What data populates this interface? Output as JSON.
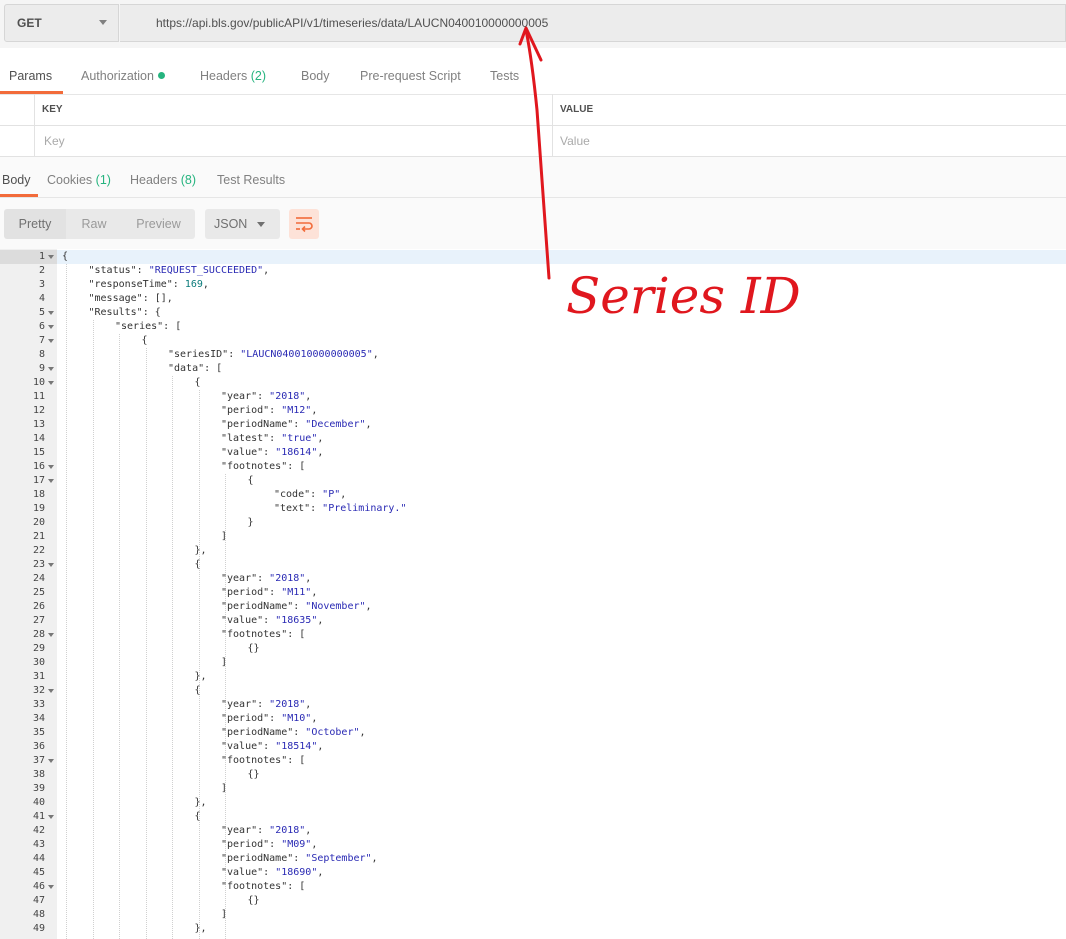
{
  "request": {
    "method": "GET",
    "url": "https://api.bls.gov/publicAPI/v1/timeseries/data/LAUCN040010000000005"
  },
  "request_tabs": [
    {
      "label": "Params",
      "count": ""
    },
    {
      "label": "Authorization",
      "count": ""
    },
    {
      "label": "Headers",
      "count": "(2)"
    },
    {
      "label": "Body",
      "count": ""
    },
    {
      "label": "Pre-request Script",
      "count": ""
    },
    {
      "label": "Tests",
      "count": ""
    }
  ],
  "params": {
    "key_header": "KEY",
    "value_header": "VALUE",
    "key_placeholder": "Key",
    "value_placeholder": "Value"
  },
  "response_tabs": [
    {
      "label": "Body",
      "count": ""
    },
    {
      "label": "Cookies",
      "count": "(1)"
    },
    {
      "label": "Headers",
      "count": "(8)"
    },
    {
      "label": "Test Results",
      "count": ""
    }
  ],
  "view": {
    "pretty": "Pretty",
    "raw": "Raw",
    "preview": "Preview",
    "format": "JSON"
  },
  "annotation": "Series ID",
  "code_lines": [
    {
      "n": "1",
      "fold": true,
      "indent": 0,
      "tokens": [
        [
          "p",
          "{"
        ]
      ]
    },
    {
      "n": "2",
      "fold": false,
      "indent": 1,
      "tokens": [
        [
          "k",
          "\"status\""
        ],
        [
          "p",
          ": "
        ],
        [
          "s",
          "\"REQUEST_SUCCEEDED\""
        ],
        [
          "p",
          ","
        ]
      ]
    },
    {
      "n": "3",
      "fold": false,
      "indent": 1,
      "tokens": [
        [
          "k",
          "\"responseTime\""
        ],
        [
          "p",
          ": "
        ],
        [
          "n",
          "169"
        ],
        [
          "p",
          ","
        ]
      ]
    },
    {
      "n": "4",
      "fold": false,
      "indent": 1,
      "tokens": [
        [
          "k",
          "\"message\""
        ],
        [
          "p",
          ": [],"
        ]
      ]
    },
    {
      "n": "5",
      "fold": true,
      "indent": 1,
      "tokens": [
        [
          "k",
          "\"Results\""
        ],
        [
          "p",
          ": {"
        ]
      ]
    },
    {
      "n": "6",
      "fold": true,
      "indent": 2,
      "tokens": [
        [
          "k",
          "\"series\""
        ],
        [
          "p",
          ": ["
        ]
      ]
    },
    {
      "n": "7",
      "fold": true,
      "indent": 3,
      "tokens": [
        [
          "p",
          "{"
        ]
      ]
    },
    {
      "n": "8",
      "fold": false,
      "indent": 4,
      "tokens": [
        [
          "k",
          "\"seriesID\""
        ],
        [
          "p",
          ": "
        ],
        [
          "s",
          "\"LAUCN040010000000005\""
        ],
        [
          "p",
          ","
        ]
      ]
    },
    {
      "n": "9",
      "fold": true,
      "indent": 4,
      "tokens": [
        [
          "k",
          "\"data\""
        ],
        [
          "p",
          ": ["
        ]
      ]
    },
    {
      "n": "10",
      "fold": true,
      "indent": 5,
      "tokens": [
        [
          "p",
          "{"
        ]
      ]
    },
    {
      "n": "11",
      "fold": false,
      "indent": 6,
      "tokens": [
        [
          "k",
          "\"year\""
        ],
        [
          "p",
          ": "
        ],
        [
          "s",
          "\"2018\""
        ],
        [
          "p",
          ","
        ]
      ]
    },
    {
      "n": "12",
      "fold": false,
      "indent": 6,
      "tokens": [
        [
          "k",
          "\"period\""
        ],
        [
          "p",
          ": "
        ],
        [
          "s",
          "\"M12\""
        ],
        [
          "p",
          ","
        ]
      ]
    },
    {
      "n": "13",
      "fold": false,
      "indent": 6,
      "tokens": [
        [
          "k",
          "\"periodName\""
        ],
        [
          "p",
          ": "
        ],
        [
          "s",
          "\"December\""
        ],
        [
          "p",
          ","
        ]
      ]
    },
    {
      "n": "14",
      "fold": false,
      "indent": 6,
      "tokens": [
        [
          "k",
          "\"latest\""
        ],
        [
          "p",
          ": "
        ],
        [
          "s",
          "\"true\""
        ],
        [
          "p",
          ","
        ]
      ]
    },
    {
      "n": "15",
      "fold": false,
      "indent": 6,
      "tokens": [
        [
          "k",
          "\"value\""
        ],
        [
          "p",
          ": "
        ],
        [
          "s",
          "\"18614\""
        ],
        [
          "p",
          ","
        ]
      ]
    },
    {
      "n": "16",
      "fold": true,
      "indent": 6,
      "tokens": [
        [
          "k",
          "\"footnotes\""
        ],
        [
          "p",
          ": ["
        ]
      ]
    },
    {
      "n": "17",
      "fold": true,
      "indent": 7,
      "tokens": [
        [
          "p",
          "{"
        ]
      ]
    },
    {
      "n": "18",
      "fold": false,
      "indent": 8,
      "tokens": [
        [
          "k",
          "\"code\""
        ],
        [
          "p",
          ": "
        ],
        [
          "s",
          "\"P\""
        ],
        [
          "p",
          ","
        ]
      ]
    },
    {
      "n": "19",
      "fold": false,
      "indent": 8,
      "tokens": [
        [
          "k",
          "\"text\""
        ],
        [
          "p",
          ": "
        ],
        [
          "s",
          "\"Preliminary.\""
        ]
      ]
    },
    {
      "n": "20",
      "fold": false,
      "indent": 7,
      "tokens": [
        [
          "p",
          "}"
        ]
      ]
    },
    {
      "n": "21",
      "fold": false,
      "indent": 6,
      "tokens": [
        [
          "p",
          "]"
        ]
      ]
    },
    {
      "n": "22",
      "fold": false,
      "indent": 5,
      "tokens": [
        [
          "p",
          "},"
        ]
      ]
    },
    {
      "n": "23",
      "fold": true,
      "indent": 5,
      "tokens": [
        [
          "p",
          "{"
        ]
      ]
    },
    {
      "n": "24",
      "fold": false,
      "indent": 6,
      "tokens": [
        [
          "k",
          "\"year\""
        ],
        [
          "p",
          ": "
        ],
        [
          "s",
          "\"2018\""
        ],
        [
          "p",
          ","
        ]
      ]
    },
    {
      "n": "25",
      "fold": false,
      "indent": 6,
      "tokens": [
        [
          "k",
          "\"period\""
        ],
        [
          "p",
          ": "
        ],
        [
          "s",
          "\"M11\""
        ],
        [
          "p",
          ","
        ]
      ]
    },
    {
      "n": "26",
      "fold": false,
      "indent": 6,
      "tokens": [
        [
          "k",
          "\"periodName\""
        ],
        [
          "p",
          ": "
        ],
        [
          "s",
          "\"November\""
        ],
        [
          "p",
          ","
        ]
      ]
    },
    {
      "n": "27",
      "fold": false,
      "indent": 6,
      "tokens": [
        [
          "k",
          "\"value\""
        ],
        [
          "p",
          ": "
        ],
        [
          "s",
          "\"18635\""
        ],
        [
          "p",
          ","
        ]
      ]
    },
    {
      "n": "28",
      "fold": true,
      "indent": 6,
      "tokens": [
        [
          "k",
          "\"footnotes\""
        ],
        [
          "p",
          ": ["
        ]
      ]
    },
    {
      "n": "29",
      "fold": false,
      "indent": 7,
      "tokens": [
        [
          "p",
          "{}"
        ]
      ]
    },
    {
      "n": "30",
      "fold": false,
      "indent": 6,
      "tokens": [
        [
          "p",
          "]"
        ]
      ]
    },
    {
      "n": "31",
      "fold": false,
      "indent": 5,
      "tokens": [
        [
          "p",
          "},"
        ]
      ]
    },
    {
      "n": "32",
      "fold": true,
      "indent": 5,
      "tokens": [
        [
          "p",
          "{"
        ]
      ]
    },
    {
      "n": "33",
      "fold": false,
      "indent": 6,
      "tokens": [
        [
          "k",
          "\"year\""
        ],
        [
          "p",
          ": "
        ],
        [
          "s",
          "\"2018\""
        ],
        [
          "p",
          ","
        ]
      ]
    },
    {
      "n": "34",
      "fold": false,
      "indent": 6,
      "tokens": [
        [
          "k",
          "\"period\""
        ],
        [
          "p",
          ": "
        ],
        [
          "s",
          "\"M10\""
        ],
        [
          "p",
          ","
        ]
      ]
    },
    {
      "n": "35",
      "fold": false,
      "indent": 6,
      "tokens": [
        [
          "k",
          "\"periodName\""
        ],
        [
          "p",
          ": "
        ],
        [
          "s",
          "\"October\""
        ],
        [
          "p",
          ","
        ]
      ]
    },
    {
      "n": "36",
      "fold": false,
      "indent": 6,
      "tokens": [
        [
          "k",
          "\"value\""
        ],
        [
          "p",
          ": "
        ],
        [
          "s",
          "\"18514\""
        ],
        [
          "p",
          ","
        ]
      ]
    },
    {
      "n": "37",
      "fold": true,
      "indent": 6,
      "tokens": [
        [
          "k",
          "\"footnotes\""
        ],
        [
          "p",
          ": ["
        ]
      ]
    },
    {
      "n": "38",
      "fold": false,
      "indent": 7,
      "tokens": [
        [
          "p",
          "{}"
        ]
      ]
    },
    {
      "n": "39",
      "fold": false,
      "indent": 6,
      "tokens": [
        [
          "p",
          "]"
        ]
      ]
    },
    {
      "n": "40",
      "fold": false,
      "indent": 5,
      "tokens": [
        [
          "p",
          "},"
        ]
      ]
    },
    {
      "n": "41",
      "fold": true,
      "indent": 5,
      "tokens": [
        [
          "p",
          "{"
        ]
      ]
    },
    {
      "n": "42",
      "fold": false,
      "indent": 6,
      "tokens": [
        [
          "k",
          "\"year\""
        ],
        [
          "p",
          ": "
        ],
        [
          "s",
          "\"2018\""
        ],
        [
          "p",
          ","
        ]
      ]
    },
    {
      "n": "43",
      "fold": false,
      "indent": 6,
      "tokens": [
        [
          "k",
          "\"period\""
        ],
        [
          "p",
          ": "
        ],
        [
          "s",
          "\"M09\""
        ],
        [
          "p",
          ","
        ]
      ]
    },
    {
      "n": "44",
      "fold": false,
      "indent": 6,
      "tokens": [
        [
          "k",
          "\"periodName\""
        ],
        [
          "p",
          ": "
        ],
        [
          "s",
          "\"September\""
        ],
        [
          "p",
          ","
        ]
      ]
    },
    {
      "n": "45",
      "fold": false,
      "indent": 6,
      "tokens": [
        [
          "k",
          "\"value\""
        ],
        [
          "p",
          ": "
        ],
        [
          "s",
          "\"18690\""
        ],
        [
          "p",
          ","
        ]
      ]
    },
    {
      "n": "46",
      "fold": true,
      "indent": 6,
      "tokens": [
        [
          "k",
          "\"footnotes\""
        ],
        [
          "p",
          ": ["
        ]
      ]
    },
    {
      "n": "47",
      "fold": false,
      "indent": 7,
      "tokens": [
        [
          "p",
          "{}"
        ]
      ]
    },
    {
      "n": "48",
      "fold": false,
      "indent": 6,
      "tokens": [
        [
          "p",
          "]"
        ]
      ]
    },
    {
      "n": "49",
      "fold": false,
      "indent": 5,
      "tokens": [
        [
          "p",
          "},"
        ]
      ]
    }
  ]
}
